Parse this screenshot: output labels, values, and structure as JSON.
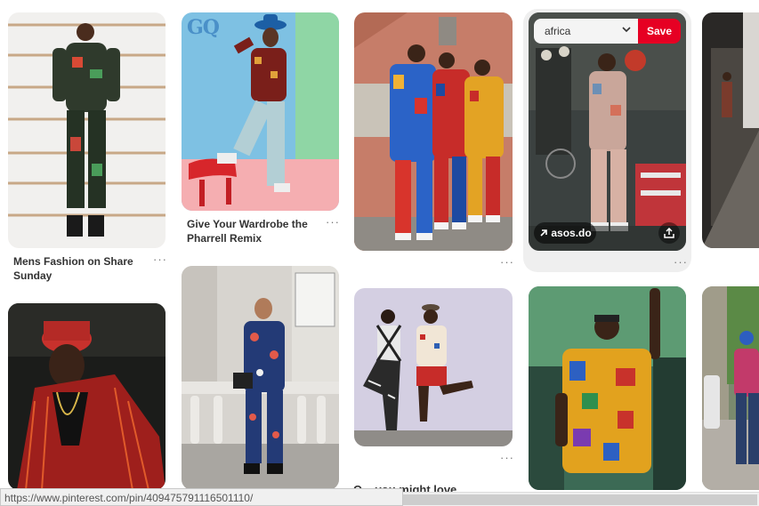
{
  "pins": [
    {
      "id": "mens-fashion",
      "title": "Mens Fashion on Share Sunday",
      "more": "···"
    },
    {
      "id": "gq-pharrell",
      "logo": "GQ",
      "title": "Give Your Wardrobe the Pharrell Remix",
      "more": "···"
    },
    {
      "id": "three-suits",
      "more": "···"
    },
    {
      "id": "asos",
      "board_value": "africa",
      "save_label": "Save",
      "link_label": "asos.do",
      "more": "···"
    },
    {
      "id": "couple-wall",
      "more": "···"
    }
  ],
  "icons": {
    "chevron": "chevron-down-icon",
    "arrow": "arrow-up-right-icon",
    "share": "share-icon",
    "more": "more-icon"
  },
  "partial_heading": "O... you might love",
  "status_url": "https://www.pinterest.com/pin/409475791116501110/",
  "colors": {
    "save": "#e60023",
    "gq_logo": "#4a90c8"
  }
}
